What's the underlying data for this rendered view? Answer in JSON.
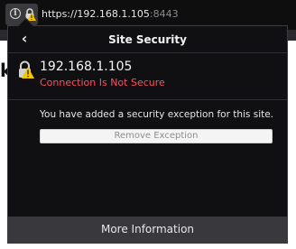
{
  "urlbar": {
    "url_host": "https://192.168.1.105",
    "url_port": ":8443"
  },
  "panel": {
    "title": "Site Security",
    "host": "192.168.1.105",
    "status": "Connection Is Not Secure",
    "exception_message": "You have added a security exception for this site.",
    "remove_button": "Remove Exception",
    "more_info_button": "More Information"
  },
  "background_page": {
    "visible_char": "k"
  },
  "colors": {
    "toolbar_bg": "#0e0e0f",
    "panel_bg": "#101012",
    "footer_bg": "#38383d",
    "warning_yellow": "#f5c400",
    "insecure_red": "#ff4f5e"
  },
  "icons": {
    "info": "info-icon",
    "lock_warning": "lock-warning-icon",
    "back": "back-arrow-icon"
  }
}
